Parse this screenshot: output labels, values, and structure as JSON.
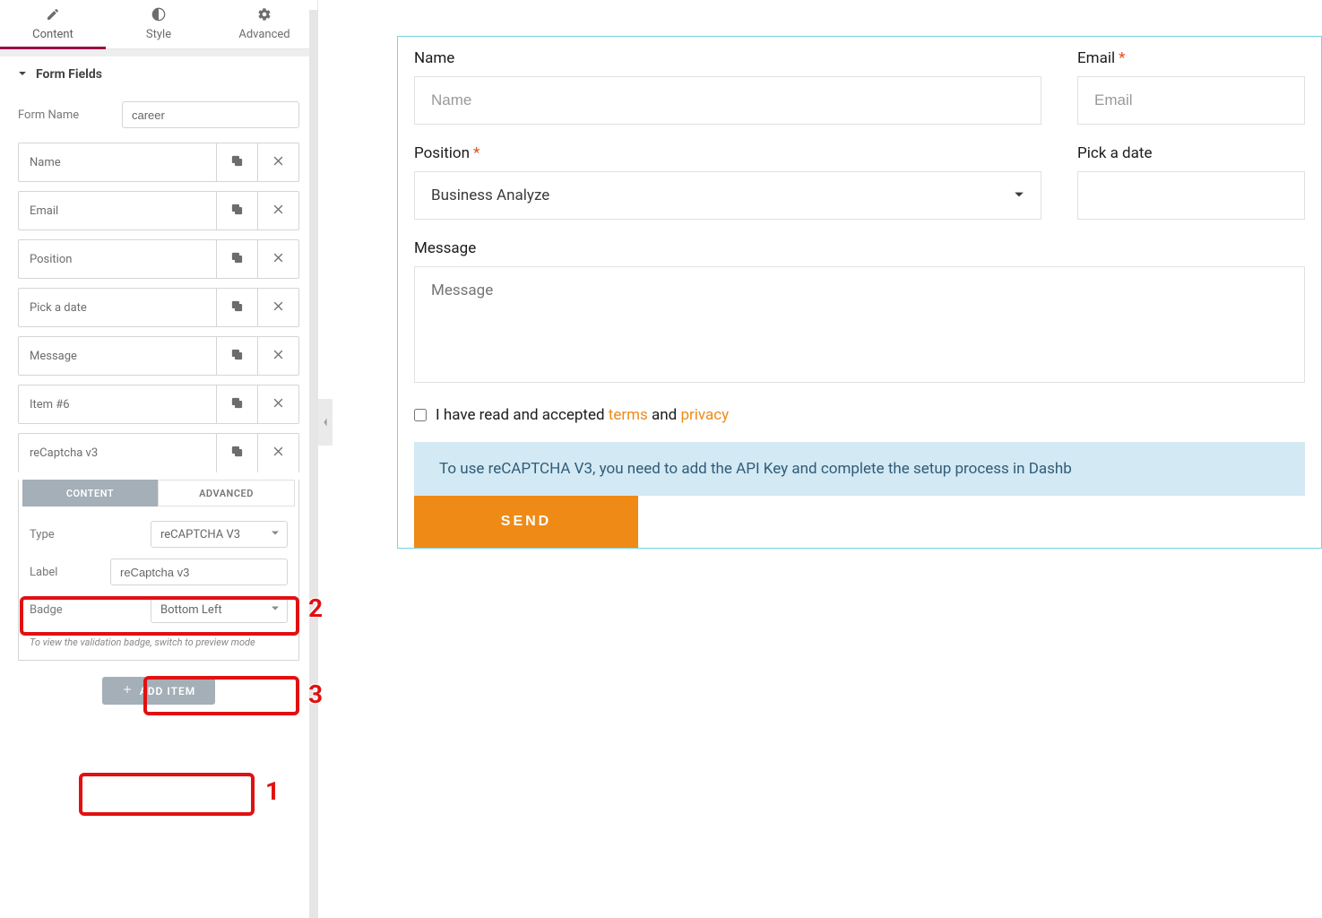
{
  "tabs": {
    "content": "Content",
    "style": "Style",
    "advanced": "Advanced"
  },
  "section": {
    "title": "Form Fields"
  },
  "form_name": {
    "label": "Form Name",
    "value": "career"
  },
  "field_items": [
    {
      "label": "Name"
    },
    {
      "label": "Email"
    },
    {
      "label": "Position"
    },
    {
      "label": "Pick a date"
    },
    {
      "label": "Message"
    },
    {
      "label": "Item #6"
    },
    {
      "label": "reCaptcha v3"
    }
  ],
  "subtabs": {
    "content": "CONTENT",
    "advanced": "ADVANCED"
  },
  "panel": {
    "type_label": "Type",
    "type_value": "reCAPTCHA V3",
    "label_label": "Label",
    "label_value": "reCaptcha v3",
    "badge_label": "Badge",
    "badge_value": "Bottom Left",
    "note": "To view the validation badge, switch to preview mode"
  },
  "add_item": "ADD ITEM",
  "annotations": {
    "n1": "1",
    "n2": "2",
    "n3": "3"
  },
  "preview": {
    "name_label": "Name",
    "name_placeholder": "Name",
    "email_label": "Email",
    "email_placeholder": "Email",
    "position_label": "Position",
    "position_value": "Business Analyze",
    "date_label": "Pick a date",
    "message_label": "Message",
    "message_placeholder": "Message",
    "accept_prefix": "I have read and accepted ",
    "accept_terms": "terms",
    "accept_and": " and ",
    "accept_privacy": "privacy",
    "alert": "To use reCAPTCHA V3, you need to add the API Key and complete the setup process in Dashb",
    "send": "SEND"
  }
}
